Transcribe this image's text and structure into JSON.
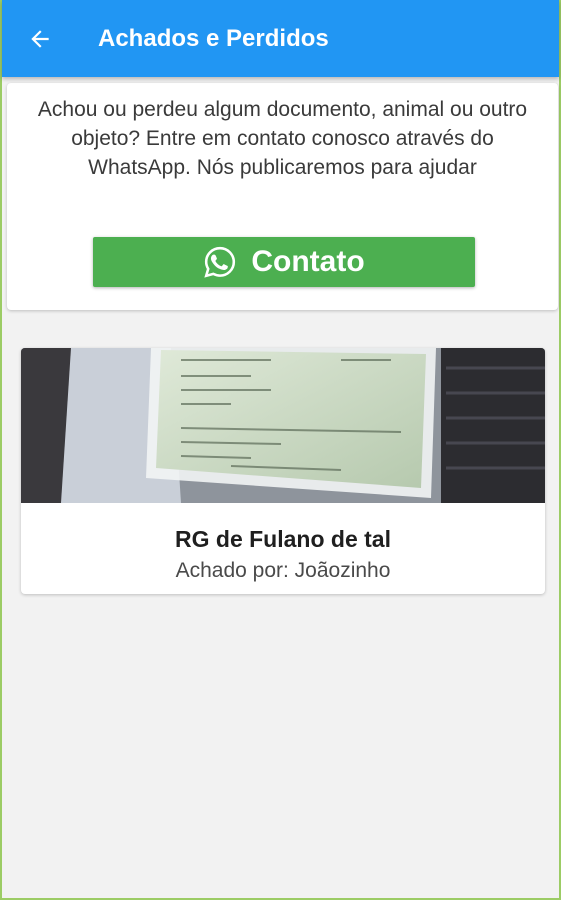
{
  "appbar": {
    "title": "Achados e Perdidos",
    "back_icon": "arrow-left-icon"
  },
  "info": {
    "text": "Achou ou perdeu algum documento, animal ou outro objeto? Entre em contato conosco através do WhatsApp. Nós publicaremos para ajudar",
    "button_label": "Contato",
    "button_icon": "whatsapp-icon"
  },
  "items": [
    {
      "title": "RG de Fulano de tal",
      "subtitle": "Achado por: Joãozinho"
    }
  ],
  "colors": {
    "appbar": "#2196f3",
    "contact_button": "#4caf50",
    "background": "#f2f2f2",
    "card": "#ffffff"
  }
}
